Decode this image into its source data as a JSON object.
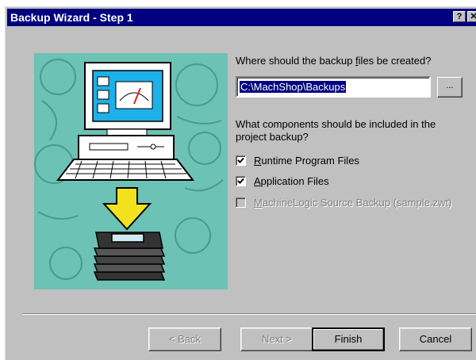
{
  "window": {
    "title": "Backup Wizard - Step 1",
    "help_button": "?",
    "close_button": "✕"
  },
  "backup_location": {
    "prompt_prefix": "Where should the backup ",
    "prompt_accel": "f",
    "prompt_suffix": "iles be created?",
    "path_value": "C:\\MachShop\\Backups",
    "browse_label": "..."
  },
  "components": {
    "prompt_line1": "What components should be included in the",
    "prompt_line2": "project backup?",
    "items": [
      {
        "accel": "R",
        "rest": "untime Program Files",
        "checked": true,
        "enabled": true
      },
      {
        "accel": "A",
        "rest": "pplication Files",
        "checked": true,
        "enabled": true
      },
      {
        "accel": "M",
        "rest": "achineLogic Source Backup (sample.zwt)",
        "checked": false,
        "enabled": false
      }
    ]
  },
  "buttons": {
    "back_label": "< Back",
    "back_accel": "B",
    "next_label": "Next >",
    "next_accel": "N",
    "finish_label": "Finish",
    "cancel_label": "Cancel"
  },
  "colors": {
    "title_bar": "#000080",
    "dialog_face": "#c0c0c0",
    "illustration_bg": "#6cc2b4",
    "monitor_screen": "#1eb0e8",
    "arrow": "#f2e21e",
    "selection": "#000080"
  }
}
